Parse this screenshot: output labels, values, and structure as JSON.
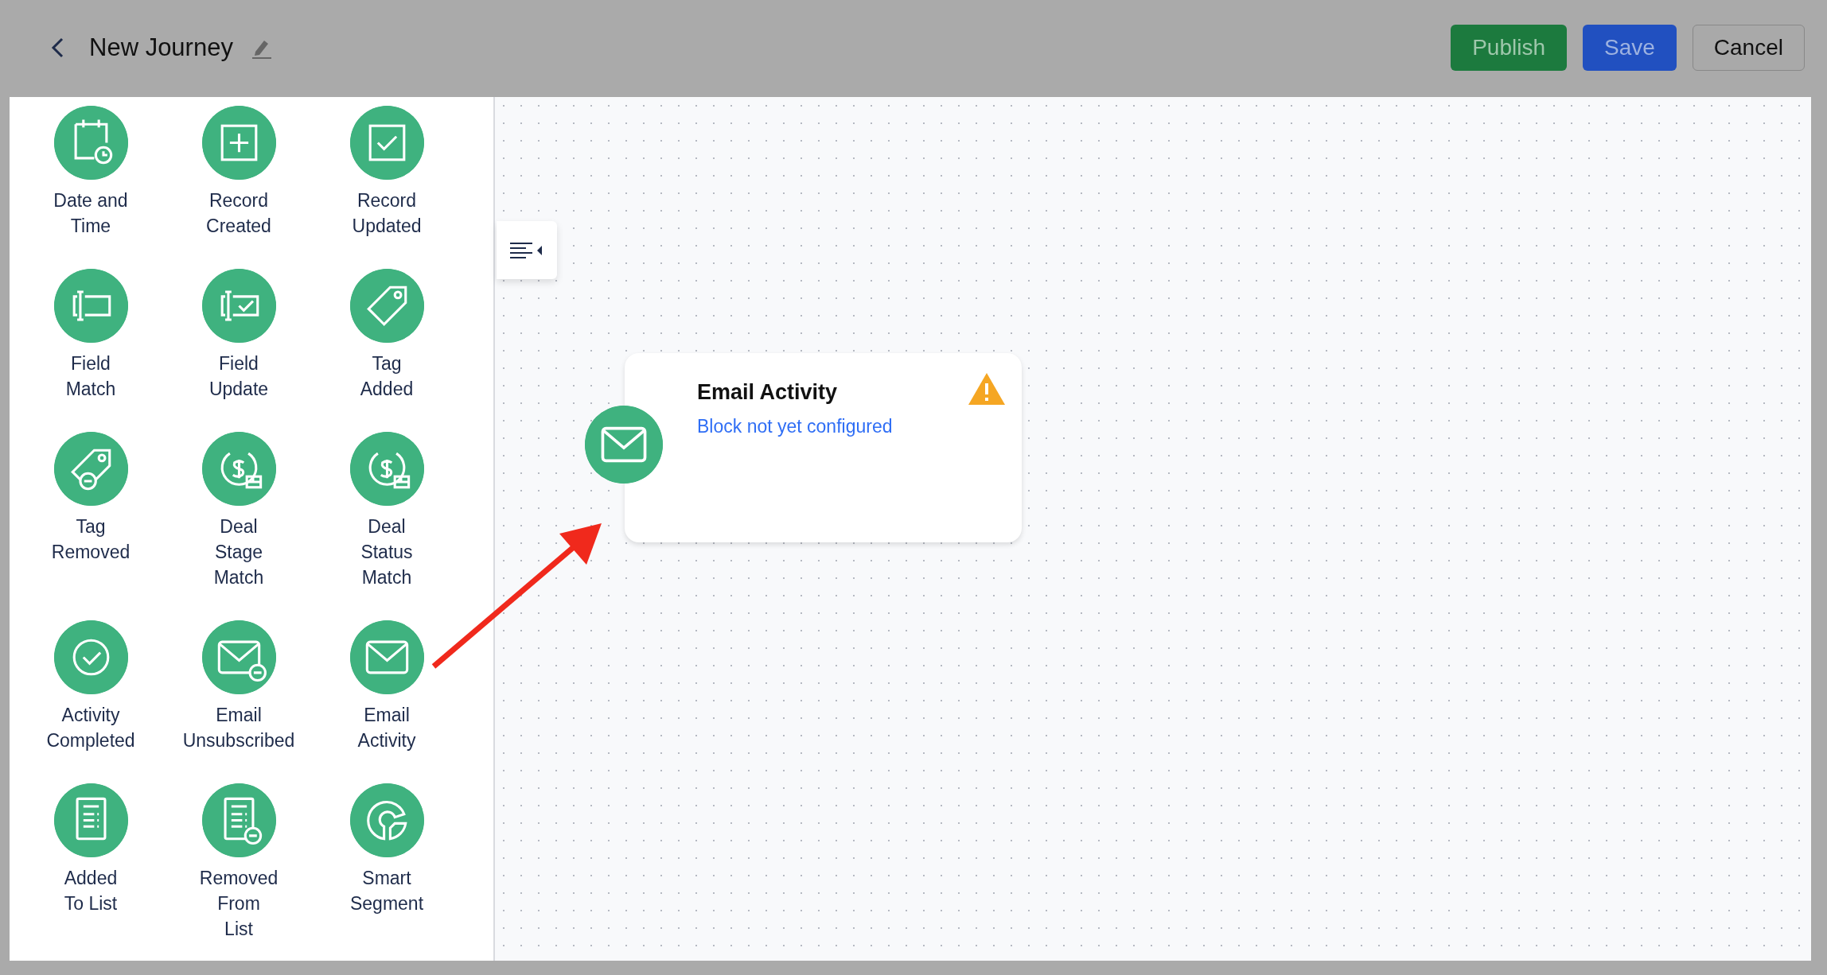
{
  "header": {
    "title": "New Journey",
    "buttons": [
      {
        "label": "Publish",
        "kind": "publish"
      },
      {
        "label": "Save",
        "kind": "save"
      },
      {
        "label": "Cancel",
        "kind": "cancel"
      }
    ]
  },
  "sidebar": {
    "items": [
      {
        "kind": "date-time",
        "label_lines": [
          "Date and",
          "Time"
        ]
      },
      {
        "kind": "record-created",
        "label_lines": [
          "Record",
          "Created"
        ]
      },
      {
        "kind": "record-updated",
        "label_lines": [
          "Record",
          "Updated"
        ]
      },
      {
        "kind": "field-match",
        "label_lines": [
          "Field",
          "Match"
        ]
      },
      {
        "kind": "field-update",
        "label_lines": [
          "Field",
          "Update"
        ]
      },
      {
        "kind": "tag-added",
        "label_lines": [
          "Tag",
          "Added"
        ]
      },
      {
        "kind": "tag-removed",
        "label_lines": [
          "Tag",
          "Removed"
        ]
      },
      {
        "kind": "deal-stage",
        "label_lines": [
          "Deal",
          "Stage",
          "Match"
        ]
      },
      {
        "kind": "deal-status",
        "label_lines": [
          "Deal",
          "Status",
          "Match"
        ]
      },
      {
        "kind": "activity-completed",
        "label_lines": [
          "Activity",
          "Completed"
        ]
      },
      {
        "kind": "email-unsubscribed",
        "label_lines": [
          "Email",
          "Unsubscribed"
        ]
      },
      {
        "kind": "email-activity",
        "label_lines": [
          "Email",
          "Activity"
        ]
      },
      {
        "kind": "added-to-list",
        "label_lines": [
          "Added",
          "To List"
        ]
      },
      {
        "kind": "removed-from-list",
        "label_lines": [
          "Removed",
          "From",
          "List"
        ]
      },
      {
        "kind": "smart-segment",
        "label_lines": [
          "Smart",
          "Segment"
        ]
      }
    ]
  },
  "canvas": {
    "node": {
      "title": "Email Activity",
      "status": "Block not yet configured",
      "warning": true
    }
  }
}
